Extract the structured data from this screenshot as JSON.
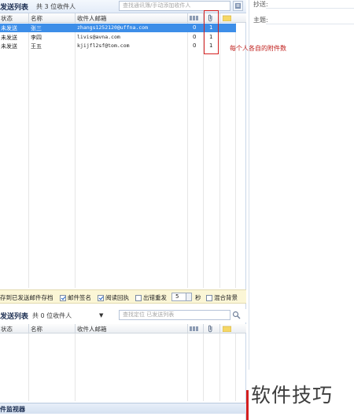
{
  "sent_list": {
    "title": "发送列表",
    "count_text": "共 3 位收件人",
    "search_placeholder": "查找通讯簿/手动添加收件人",
    "columns": {
      "status": "状态",
      "name": "名称",
      "email": "收件人邮箱"
    },
    "rows": [
      {
        "status": "未发送",
        "name": "张三",
        "email": "zhangs1252120@uffna.com",
        "col_a": "0",
        "col_b": "1",
        "selected": true
      },
      {
        "status": "未发送",
        "name": "李四",
        "email": "livis@avna.com",
        "col_a": "0",
        "col_b": "1",
        "selected": false
      },
      {
        "status": "未发送",
        "name": "王五",
        "email": "kjijfl2sf@tom.com",
        "col_a": "0",
        "col_b": "1",
        "selected": false
      }
    ]
  },
  "annotation": "每个人各自的附件数",
  "options": {
    "save_to_sent": "存到已发送邮件存档",
    "signature": "邮件签名",
    "read_receipt": "阅读回执",
    "retry_on_error": "出错重发",
    "retry_seconds": "5",
    "seconds_unit": "秒",
    "mixed_background": "混合背景",
    "signature_checked": true,
    "read_receipt_checked": true,
    "retry_checked": false,
    "mixed_checked": false
  },
  "sent_done_list": {
    "title": "发送列表",
    "count_text": "共 0 位收件人",
    "search_placeholder": "查找定位 已发送列表",
    "columns": {
      "status": "状态",
      "name": "名称",
      "email": "收件人邮箱"
    }
  },
  "monitor": {
    "title": "件监视器"
  },
  "right_pane": {
    "cc_label": "抄送:",
    "subject_label": "主题:"
  },
  "watermark": "软件技巧"
}
